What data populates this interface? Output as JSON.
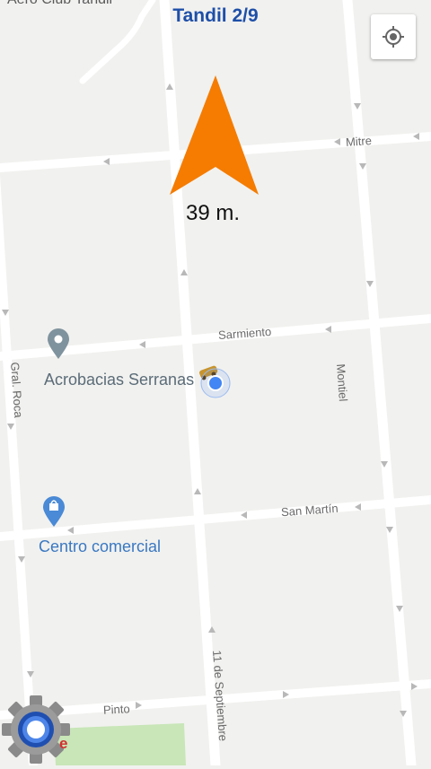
{
  "header": {
    "title": "Tandil 2/9"
  },
  "map": {
    "top_label": "Aero Club Tandil",
    "streets": {
      "mitre": "Mitre",
      "sarmiento": "Sarmiento",
      "san_martin": "San Martín",
      "pinto": "Pinto",
      "montiel": "Montiel",
      "gral_roca": "Gral. Roca",
      "once_septiembre": "11 de Septiembre"
    },
    "pois": {
      "acrobacias": "Acrobacias Serranas",
      "centro": "Centro comercial"
    },
    "colors": {
      "road": "#ffffff",
      "land": "#f1f1ef",
      "park": "#c8e6b8",
      "arrow": "#f57c00",
      "user_dot": "#4285f4",
      "poi_gray_marker": "#7f939e",
      "poi_blue_marker": "#4a8ad6"
    }
  },
  "navigation": {
    "distance": "39 m."
  },
  "controls": {
    "locate_icon": "my-location-icon",
    "settings_icon": "gear-icon",
    "settings_badge": "e"
  }
}
